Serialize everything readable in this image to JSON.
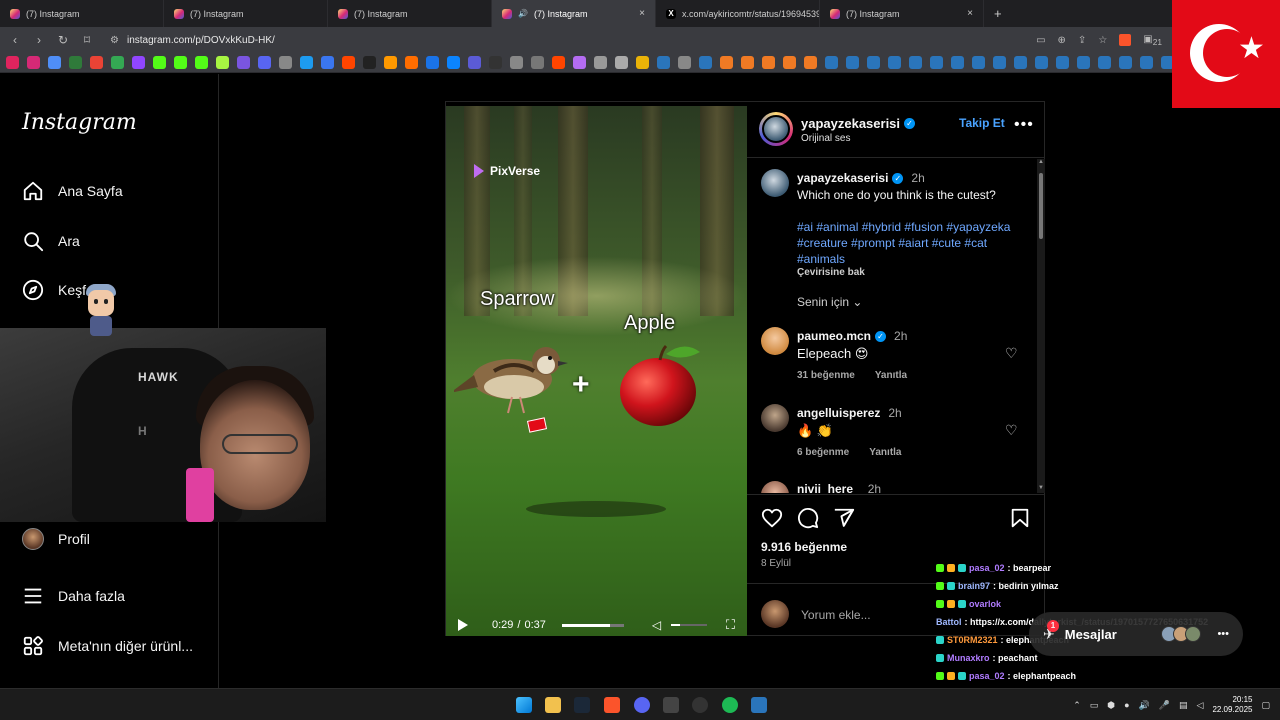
{
  "browser": {
    "tabs": [
      {
        "title": "(7) Instagram",
        "active": false
      },
      {
        "title": "(7) Instagram",
        "active": false
      },
      {
        "title": "(7) Instagram",
        "active": false
      },
      {
        "title": "(7) Instagram",
        "active": true
      },
      {
        "title": "x.com/aykiricomtr/status/19694539...",
        "active": false
      },
      {
        "title": "(7) Instagram",
        "active": false
      }
    ],
    "url": "instagram.com/p/DOVxkKuD-HK/",
    "new_tab": "+",
    "close_tab": "×",
    "ext_badge": "21",
    "bookmark_colors": [
      "#e0245e",
      "#d62976",
      "#4f8ef7",
      "#2f7a3a",
      "#ea4335",
      "#34a853",
      "#9146ff",
      "#53fc18",
      "#53fc18",
      "#53fc18",
      "#a8f542",
      "#7a55e0",
      "#5865f2",
      "#888888",
      "#1d9bf0",
      "#3a76f0",
      "#ff4500",
      "#222222",
      "#ff9900",
      "#ff6d00",
      "#1a73e8",
      "#0b84ff",
      "#5b5bd6",
      "#333333",
      "#888888",
      "#777777",
      "#ff4500",
      "#b46cf2",
      "#999999",
      "#aaaaaa",
      "#eab308",
      "#2a75bb",
      "#888888",
      "#2a75bb",
      "#f07a24",
      "#f07a24",
      "#f07a24",
      "#f07a24",
      "#f07a24",
      "#2a75bb",
      "#2a75bb",
      "#2a75bb",
      "#2a75bb",
      "#2a75bb",
      "#2a75bb",
      "#2a75bb",
      "#2a75bb",
      "#2a75bb",
      "#2a75bb",
      "#2a75bb",
      "#2a75bb",
      "#2a75bb",
      "#2a75bb",
      "#2a75bb",
      "#2a75bb",
      "#2a75bb"
    ]
  },
  "sidebar": {
    "logo": "Instagram",
    "items": [
      {
        "label": "Ana Sayfa",
        "icon": "home-icon"
      },
      {
        "label": "Ara",
        "icon": "search-icon"
      },
      {
        "label": "Keşfet",
        "icon": "compass-icon"
      },
      {
        "label": "Profil",
        "icon": "avatar"
      },
      {
        "label": "Daha fazla",
        "icon": "menu-icon"
      },
      {
        "label": "Meta'nın diğer ürünl...",
        "icon": "apps-grid-icon"
      }
    ]
  },
  "webcam": {
    "chair_brand": "HAWK",
    "chair_brand_2": "H"
  },
  "post": {
    "media": {
      "watermark": "PixVerse",
      "label_left": "Sparrow",
      "label_right": "Apple",
      "plus": "+",
      "time_current": "0:29",
      "time_total": "0:37",
      "progress": 0.78,
      "volume": 0.25
    },
    "author": {
      "username": "yapayzekaserisi",
      "audio": "Orijinal ses",
      "follow_label": "Takip Et",
      "more": "•••"
    },
    "caption": {
      "username": "yapayzekaserisi",
      "time": "2h",
      "text": "Which one do you think is the cutest?",
      "hashtags": "#ai #animal #hybrid #fusion #yapayzeka #creature #prompt #aiart #cute #cat #animals",
      "translate": "Çevirisine bak",
      "sort": "Senin için"
    },
    "comments": [
      {
        "username": "paumeo.mcn",
        "verified": true,
        "time": "2h",
        "text": "Elepeach 😍",
        "likes": "31 beğenme",
        "reply": "Yanıtla"
      },
      {
        "username": "angelluisperez",
        "verified": false,
        "time": "2h",
        "text": "🔥 👏",
        "likes": "6 beğenme",
        "reply": "Yanıtla"
      },
      {
        "username": "nivii_here_",
        "verified": false,
        "time": "2h",
        "text": "",
        "likes": "",
        "reply": ""
      }
    ],
    "like_count": "9.916 beğenme",
    "date": "8 Eylül",
    "comment_placeholder": "Yorum ekle..."
  },
  "chat": {
    "lines": [
      {
        "user": "pasa_02",
        "color": "#b07cff",
        "text": ": bearpear"
      },
      {
        "user": "brain97",
        "color": "#9fb8ff",
        "text": ": bedirin yılmaz"
      },
      {
        "user": "ovarlok",
        "color": "#b07cff",
        "text": ""
      },
      {
        "user": "Battol",
        "color": "#9fb8ff",
        "text": ": https://x.com/dailyturkist_/status/1970157727650631752"
      },
      {
        "user": "ST0RM2321",
        "color": "#ff9a3c",
        "text": ": elephantpeach"
      },
      {
        "user": "Munaxkro",
        "color": "#b07cff",
        "text": ": peachant"
      },
      {
        "user": "pasa_02",
        "color": "#b07cff",
        "text": ": elephantpeach"
      }
    ],
    "messages_label": "Mesajlar",
    "messages_badge": "1"
  },
  "taskbar": {
    "time": "20:15",
    "date": "22.09.2025"
  }
}
